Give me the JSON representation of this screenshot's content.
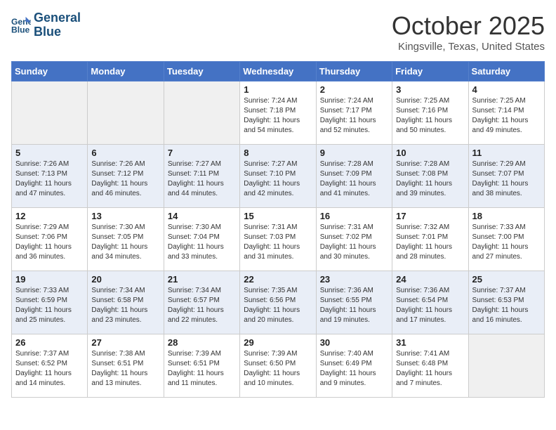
{
  "header": {
    "logo_line1": "General",
    "logo_line2": "Blue",
    "month_title": "October 2025",
    "location": "Kingsville, Texas, United States"
  },
  "days_of_week": [
    "Sunday",
    "Monday",
    "Tuesday",
    "Wednesday",
    "Thursday",
    "Friday",
    "Saturday"
  ],
  "weeks": [
    {
      "days": [
        {
          "number": "",
          "info": ""
        },
        {
          "number": "",
          "info": ""
        },
        {
          "number": "",
          "info": ""
        },
        {
          "number": "1",
          "info": "Sunrise: 7:24 AM\nSunset: 7:18 PM\nDaylight: 11 hours\nand 54 minutes."
        },
        {
          "number": "2",
          "info": "Sunrise: 7:24 AM\nSunset: 7:17 PM\nDaylight: 11 hours\nand 52 minutes."
        },
        {
          "number": "3",
          "info": "Sunrise: 7:25 AM\nSunset: 7:16 PM\nDaylight: 11 hours\nand 50 minutes."
        },
        {
          "number": "4",
          "info": "Sunrise: 7:25 AM\nSunset: 7:14 PM\nDaylight: 11 hours\nand 49 minutes."
        }
      ]
    },
    {
      "days": [
        {
          "number": "5",
          "info": "Sunrise: 7:26 AM\nSunset: 7:13 PM\nDaylight: 11 hours\nand 47 minutes."
        },
        {
          "number": "6",
          "info": "Sunrise: 7:26 AM\nSunset: 7:12 PM\nDaylight: 11 hours\nand 46 minutes."
        },
        {
          "number": "7",
          "info": "Sunrise: 7:27 AM\nSunset: 7:11 PM\nDaylight: 11 hours\nand 44 minutes."
        },
        {
          "number": "8",
          "info": "Sunrise: 7:27 AM\nSunset: 7:10 PM\nDaylight: 11 hours\nand 42 minutes."
        },
        {
          "number": "9",
          "info": "Sunrise: 7:28 AM\nSunset: 7:09 PM\nDaylight: 11 hours\nand 41 minutes."
        },
        {
          "number": "10",
          "info": "Sunrise: 7:28 AM\nSunset: 7:08 PM\nDaylight: 11 hours\nand 39 minutes."
        },
        {
          "number": "11",
          "info": "Sunrise: 7:29 AM\nSunset: 7:07 PM\nDaylight: 11 hours\nand 38 minutes."
        }
      ]
    },
    {
      "days": [
        {
          "number": "12",
          "info": "Sunrise: 7:29 AM\nSunset: 7:06 PM\nDaylight: 11 hours\nand 36 minutes."
        },
        {
          "number": "13",
          "info": "Sunrise: 7:30 AM\nSunset: 7:05 PM\nDaylight: 11 hours\nand 34 minutes."
        },
        {
          "number": "14",
          "info": "Sunrise: 7:30 AM\nSunset: 7:04 PM\nDaylight: 11 hours\nand 33 minutes."
        },
        {
          "number": "15",
          "info": "Sunrise: 7:31 AM\nSunset: 7:03 PM\nDaylight: 11 hours\nand 31 minutes."
        },
        {
          "number": "16",
          "info": "Sunrise: 7:31 AM\nSunset: 7:02 PM\nDaylight: 11 hours\nand 30 minutes."
        },
        {
          "number": "17",
          "info": "Sunrise: 7:32 AM\nSunset: 7:01 PM\nDaylight: 11 hours\nand 28 minutes."
        },
        {
          "number": "18",
          "info": "Sunrise: 7:33 AM\nSunset: 7:00 PM\nDaylight: 11 hours\nand 27 minutes."
        }
      ]
    },
    {
      "days": [
        {
          "number": "19",
          "info": "Sunrise: 7:33 AM\nSunset: 6:59 PM\nDaylight: 11 hours\nand 25 minutes."
        },
        {
          "number": "20",
          "info": "Sunrise: 7:34 AM\nSunset: 6:58 PM\nDaylight: 11 hours\nand 23 minutes."
        },
        {
          "number": "21",
          "info": "Sunrise: 7:34 AM\nSunset: 6:57 PM\nDaylight: 11 hours\nand 22 minutes."
        },
        {
          "number": "22",
          "info": "Sunrise: 7:35 AM\nSunset: 6:56 PM\nDaylight: 11 hours\nand 20 minutes."
        },
        {
          "number": "23",
          "info": "Sunrise: 7:36 AM\nSunset: 6:55 PM\nDaylight: 11 hours\nand 19 minutes."
        },
        {
          "number": "24",
          "info": "Sunrise: 7:36 AM\nSunset: 6:54 PM\nDaylight: 11 hours\nand 17 minutes."
        },
        {
          "number": "25",
          "info": "Sunrise: 7:37 AM\nSunset: 6:53 PM\nDaylight: 11 hours\nand 16 minutes."
        }
      ]
    },
    {
      "days": [
        {
          "number": "26",
          "info": "Sunrise: 7:37 AM\nSunset: 6:52 PM\nDaylight: 11 hours\nand 14 minutes."
        },
        {
          "number": "27",
          "info": "Sunrise: 7:38 AM\nSunset: 6:51 PM\nDaylight: 11 hours\nand 13 minutes."
        },
        {
          "number": "28",
          "info": "Sunrise: 7:39 AM\nSunset: 6:51 PM\nDaylight: 11 hours\nand 11 minutes."
        },
        {
          "number": "29",
          "info": "Sunrise: 7:39 AM\nSunset: 6:50 PM\nDaylight: 11 hours\nand 10 minutes."
        },
        {
          "number": "30",
          "info": "Sunrise: 7:40 AM\nSunset: 6:49 PM\nDaylight: 11 hours\nand 9 minutes."
        },
        {
          "number": "31",
          "info": "Sunrise: 7:41 AM\nSunset: 6:48 PM\nDaylight: 11 hours\nand 7 minutes."
        },
        {
          "number": "",
          "info": ""
        }
      ]
    }
  ],
  "row_styles": [
    "light",
    "dark",
    "light",
    "dark",
    "light"
  ]
}
